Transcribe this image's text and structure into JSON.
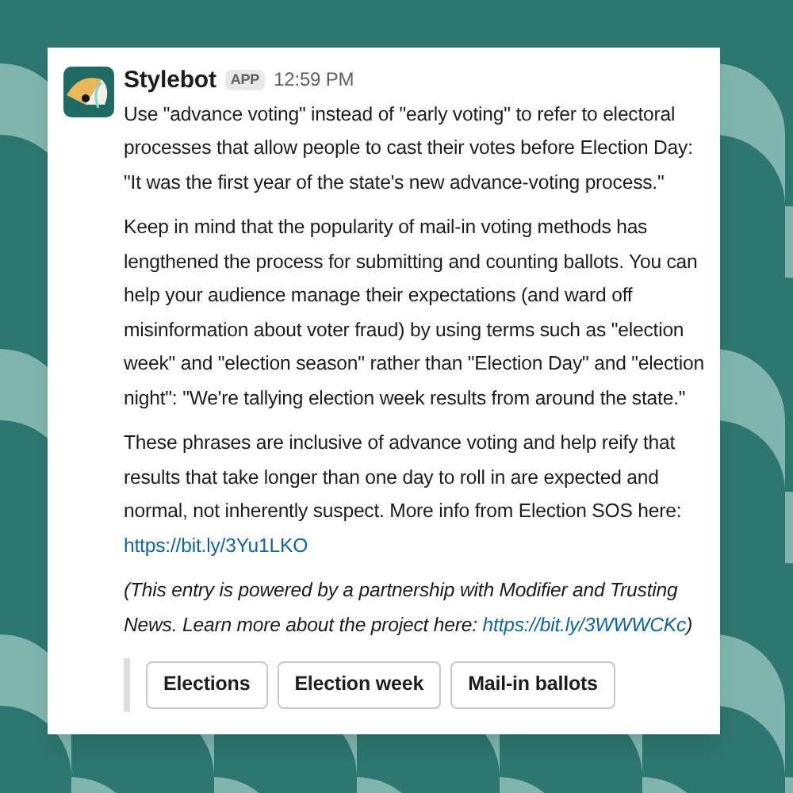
{
  "message": {
    "sender": "Stylebot",
    "badge": "APP",
    "time": "12:59 PM",
    "paragraphs": [
      {
        "kind": "plain",
        "text": "Use \"advance voting\" instead of \"early voting\" to refer to electoral processes that allow people to cast their votes before Election Day: \"It was the first year of the state's new advance-voting process.\""
      },
      {
        "kind": "plain",
        "text": "Keep in mind that the popularity of mail-in voting methods has lengthened the process for submitting and counting ballots. You can help your audience manage their expectations (and ward off misinformation about voter fraud) by using terms such as \"election week\" and \"election season\" rather than \"Election Day\" and \"election night\": \"We're tallying election week results from around the state.\""
      },
      {
        "kind": "plain",
        "text": "These phrases are inclusive of advance voting and help reify that results that take longer than one day to roll in are expected and normal, not inherently suspect. More info from Election SOS here: ",
        "link": "https://bit.ly/3Yu1LKO"
      },
      {
        "kind": "note",
        "text": "(This entry is powered by a partnership with Modifier and Trusting News. Learn more about the project here: ",
        "link": "https://bit.ly/3WWWCKc",
        "after": ")"
      }
    ],
    "buttons": [
      "Elections",
      "Election week",
      "Mail-in ballots"
    ]
  }
}
